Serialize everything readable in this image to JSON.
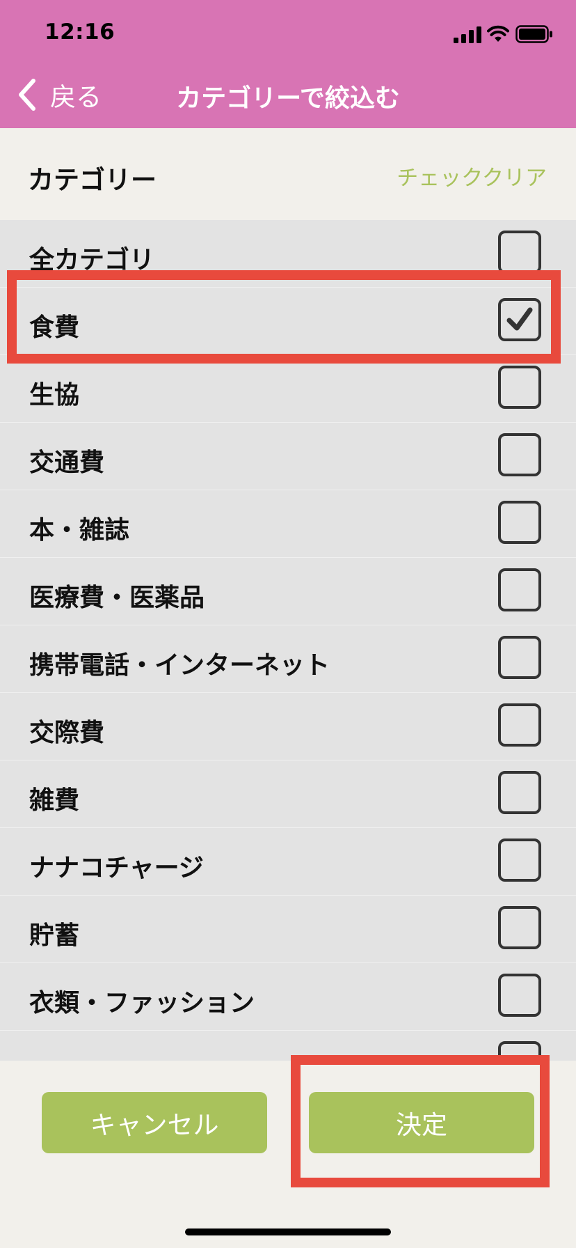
{
  "status_bar": {
    "time": "12:16"
  },
  "nav": {
    "back_label": "戻る",
    "title": "カテゴリーで絞込む"
  },
  "section": {
    "title": "カテゴリー",
    "clear_label": "チェッククリア"
  },
  "categories": [
    {
      "label": "全カテゴリ",
      "checked": false
    },
    {
      "label": "食費",
      "checked": true
    },
    {
      "label": "生協",
      "checked": false
    },
    {
      "label": "交通費",
      "checked": false
    },
    {
      "label": "本・雑誌",
      "checked": false
    },
    {
      "label": "医療費・医薬品",
      "checked": false
    },
    {
      "label": "携帯電話・インターネット",
      "checked": false
    },
    {
      "label": "交際費",
      "checked": false
    },
    {
      "label": "雑費",
      "checked": false
    },
    {
      "label": "ナナコチャージ",
      "checked": false
    },
    {
      "label": "貯蓄",
      "checked": false
    },
    {
      "label": "衣類・ファッション",
      "checked": false
    },
    {
      "label": "",
      "checked": false
    }
  ],
  "buttons": {
    "cancel_label": "キャンセル",
    "confirm_label": "決定"
  },
  "colors": {
    "header_bg": "#d874b4",
    "accent_green": "#a9c25c",
    "list_bg": "#e3e3e3",
    "highlight_red": "#e84a3d"
  },
  "icons": {
    "back": "chevron-left-icon",
    "check": "checkmark-icon",
    "signal": "cellular-signal-icon",
    "wifi": "wifi-icon",
    "battery": "battery-icon"
  }
}
